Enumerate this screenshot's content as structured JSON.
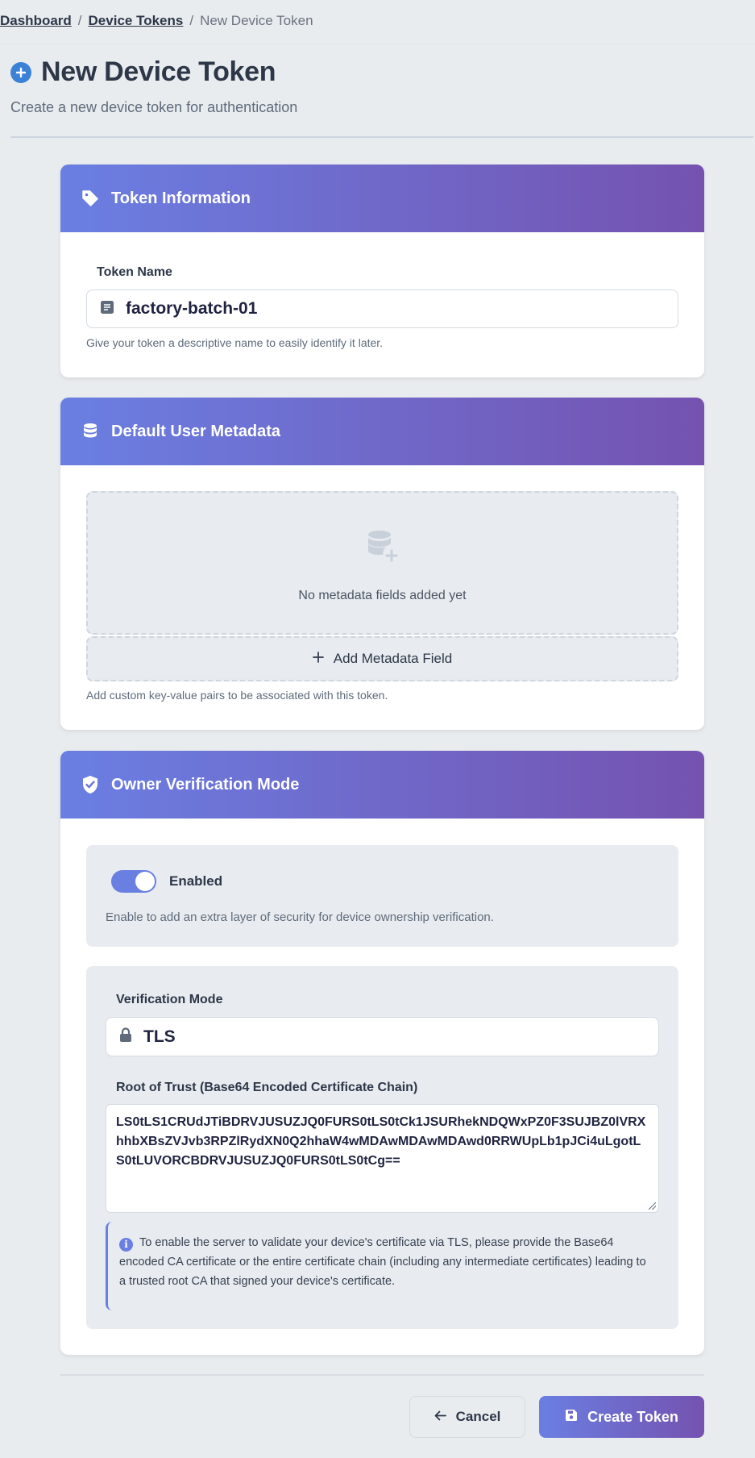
{
  "breadcrumb": {
    "items": [
      {
        "label": "Dashboard"
      },
      {
        "label": "Device Tokens"
      },
      {
        "label": "New Device Token"
      }
    ],
    "separator": "/"
  },
  "header": {
    "icon": "plus-circle-icon",
    "title": "New Device Token",
    "subtitle": "Create a new device token for authentication"
  },
  "token_info": {
    "heading": "Token Information",
    "icon": "tag-icon",
    "name_label": "Token Name",
    "name_value": "factory-batch-01",
    "name_hint": "Give your token a descriptive name to easily identify it later."
  },
  "metadata": {
    "heading": "Default User Metadata",
    "icon": "database-icon",
    "empty_text": "No metadata fields added yet",
    "add_label": "Add Metadata Field",
    "hint": "Add custom key-value pairs to be associated with this token."
  },
  "verification": {
    "heading": "Owner Verification Mode",
    "icon": "shield-check-icon",
    "toggle_label": "Enabled",
    "toggle_on": true,
    "toggle_hint": "Enable to add an extra layer of security for device ownership verification.",
    "mode_label": "Verification Mode",
    "mode_value": "TLS",
    "root_label": "Root of Trust (Base64 Encoded Certificate Chain)",
    "root_value": "LS0tLS1CRUdJTiBDRVJUSUZJQ0FURS0tLS0tCk1JSURhekNDQWxPZ0F3SUJBZ0lVRXhhbXBsZVJvb3RPZlRydXN0Q2hhaW4wMDAwMDAwMDAwd0RRWUpLb1pJCi4uLgotLS0tLUVORCBDRVJUSUZJQ0FURS0tLS0tCg==",
    "info_text": "To enable the server to validate your device's certificate via TLS, please provide the Base64 encoded CA certificate or the entire certificate chain (including any intermediate certificates) leading to a trusted root CA that signed your device's certificate."
  },
  "footer": {
    "cancel_label": "Cancel",
    "create_label": "Create Token"
  },
  "colors": {
    "accent_start": "#6a7fe2",
    "accent_end": "#7552b0",
    "link_blue": "#3b82d6"
  }
}
